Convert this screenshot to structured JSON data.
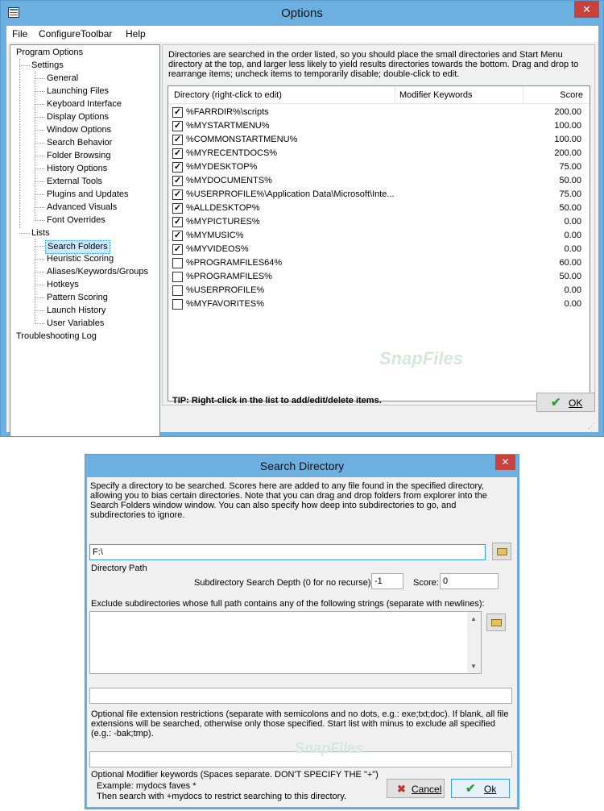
{
  "options_window": {
    "title": "Options",
    "close_glyph": "✕",
    "menu": [
      "File",
      "ConfigureToolbar",
      "Help"
    ],
    "tree": {
      "program_options": "Program Options",
      "settings": "Settings",
      "settings_items": [
        "General",
        "Launching Files",
        "Keyboard Interface",
        "Display Options",
        "Window Options",
        "Search Behavior",
        "Folder Browsing",
        "History Options",
        "External Tools",
        "Plugins and Updates",
        "Advanced Visuals",
        "Font Overrides"
      ],
      "lists": "Lists",
      "lists_items": [
        "Search Folders",
        "Heuristic Scoring",
        "Aliases/Keywords/Groups",
        "Hotkeys",
        "Pattern Scoring",
        "Launch History",
        "User Variables"
      ],
      "troubleshooting": "Troubleshooting Log",
      "selected": "Search Folders"
    },
    "description": "Directories are searched in the order listed, so you should place the small directories and Start Menu directory at the top, and larger less likely to yield results directories towards the bottom.  Drag and drop to rearrange items; uncheck items to temporarily disable; double-click to edit.",
    "columns": {
      "directory": "Directory (right-click to edit)",
      "keywords": "Modifier Keywords",
      "score": "Score"
    },
    "rows": [
      {
        "dir": "%FARRDIR%\\scripts",
        "checked": true,
        "score": "200.00"
      },
      {
        "dir": "%MYSTARTMENU%",
        "checked": true,
        "score": "100.00"
      },
      {
        "dir": "%COMMONSTARTMENU%",
        "checked": true,
        "score": "100.00"
      },
      {
        "dir": "%MYRECENTDOCS%",
        "checked": true,
        "score": "200.00"
      },
      {
        "dir": "%MYDESKTOP%",
        "checked": true,
        "score": "75.00"
      },
      {
        "dir": "%MYDOCUMENTS%",
        "checked": true,
        "score": "50.00"
      },
      {
        "dir": "%USERPROFILE%\\Application Data\\Microsoft\\Inte...",
        "checked": true,
        "score": "75.00"
      },
      {
        "dir": "%ALLDESKTOP%",
        "checked": true,
        "score": "50.00"
      },
      {
        "dir": "%MYPICTURES%",
        "checked": true,
        "score": "0.00"
      },
      {
        "dir": "%MYMUSIC%",
        "checked": true,
        "score": "0.00"
      },
      {
        "dir": "%MYVIDEOS%",
        "checked": true,
        "score": "0.00"
      },
      {
        "dir": "%PROGRAMFILES64%",
        "checked": false,
        "score": "60.00"
      },
      {
        "dir": "%PROGRAMFILES%",
        "checked": false,
        "score": "50.00"
      },
      {
        "dir": "%USERPROFILE%",
        "checked": false,
        "score": "0.00"
      },
      {
        "dir": "%MYFAVORITES%",
        "checked": false,
        "score": "0.00"
      }
    ],
    "tip": "TIP: Right-click in the list to add/edit/delete items.",
    "ok_label": "OK",
    "watermark": "SnapFiles"
  },
  "search_dialog": {
    "title": "Search Directory",
    "close_glyph": "✕",
    "intro": "Specify a directory to be searched. Scores here are added to any file found in the specified directory, allowing you to bias certain directories.  Note that you can drag and drop folders from explorer into the Search Folders window window.  You can also specify how deep into subdirectories to go, and subdirectories to ignore.",
    "path_value": "F:\\",
    "path_label": "Directory Path",
    "depth_label": "Subdirectory Search Depth (0 for no recurse):",
    "depth_value": "-1",
    "score_label": "Score:",
    "score_value": "0",
    "exclude_label": "Exclude subdirectories whose full path contains any of the following strings (separate with newlines):",
    "exclude_value": "",
    "ext_value": "",
    "ext_help": "Optional file extension restrictions (separate with semicolons and no dots, e.g.: exe;txt;doc).  If blank, all file extensions will be searched, otherwise only those specified.  Start list with minus to exclude all specified (e.g.: -bak;tmp).",
    "keywords_value": "",
    "keywords_help": "Optional Modifier keywords (Spaces separate. DON'T SPECIFY THE \"+\")",
    "example_line1": "Example: mydocs faves *",
    "example_line2": "Then search with +mydocs to restrict searching to this directory.",
    "cancel_label": "Cancel",
    "ok_label": "Ok"
  },
  "colors": {
    "titlebar": "#6cb0e2",
    "close": "#c7423a",
    "selection": "#cce8ff",
    "ok_check": "#2e9e2e"
  }
}
